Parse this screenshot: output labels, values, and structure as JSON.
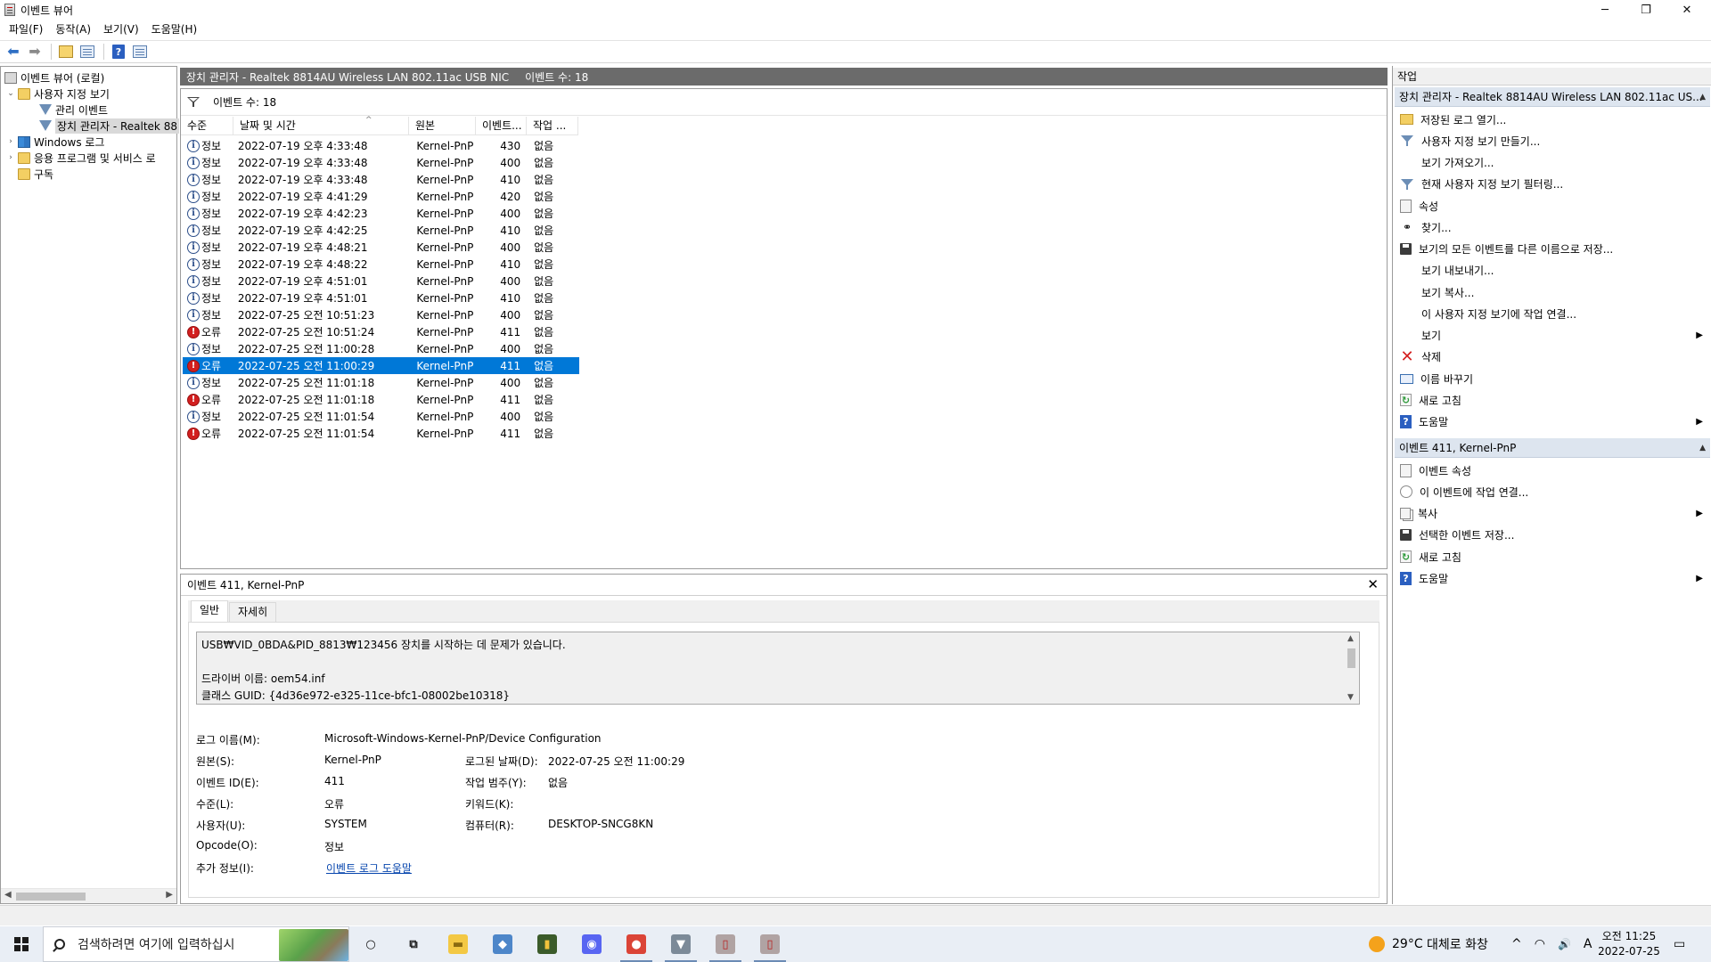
{
  "window": {
    "title": "이벤트 뷰어",
    "controls": {
      "minimize": "─",
      "maximize": "❐",
      "close": "✕"
    }
  },
  "menu": [
    "파일(F)",
    "동작(A)",
    "보기(V)",
    "도움말(H)"
  ],
  "toolbar": {
    "icons": [
      "back-arrow-icon",
      "forward-arrow-icon",
      "up-folder-icon",
      "show-hide-tree-icon",
      "help-icon",
      "action-pane-icon"
    ],
    "back_glyph": "⬅",
    "forward_glyph": "➡",
    "help_glyph": "?"
  },
  "tree": {
    "items": [
      {
        "label": "이벤트 뷰어 (로컬)",
        "expander": "",
        "icon": "computer-icon"
      },
      {
        "label": "사용자 지정 보기",
        "expander": "⌄",
        "icon": "folder-icon"
      },
      {
        "label": "관리 이벤트",
        "expander": "",
        "icon": "filter-icon"
      },
      {
        "label": "장치 관리자 - Realtek 88",
        "expander": "",
        "icon": "filter-icon"
      },
      {
        "label": "Windows 로그",
        "expander": "›",
        "icon": "windows-log-icon"
      },
      {
        "label": "응용 프로그램 및 서비스 로",
        "expander": "›",
        "icon": "folder-icon"
      },
      {
        "label": "구독",
        "expander": "",
        "icon": "folder-icon"
      }
    ],
    "selected_index": 3
  },
  "center": {
    "header_title": "장치 관리자 - Realtek 8814AU Wireless LAN 802.11ac USB NIC",
    "header_count": "이벤트 수: 18",
    "filter_text": "이벤트 수: 18",
    "columns": [
      "수준",
      "날짜 및 시간",
      "원본",
      "이벤트...",
      "작업 ..."
    ],
    "sort_glyph": "^",
    "rows": [
      {
        "level": "정보",
        "type": "info",
        "datetime": "2022-07-19 오후 4:33:48",
        "source": "Kernel-PnP",
        "id": "430",
        "task": "없음"
      },
      {
        "level": "정보",
        "type": "info",
        "datetime": "2022-07-19 오후 4:33:48",
        "source": "Kernel-PnP",
        "id": "400",
        "task": "없음"
      },
      {
        "level": "정보",
        "type": "info",
        "datetime": "2022-07-19 오후 4:33:48",
        "source": "Kernel-PnP",
        "id": "410",
        "task": "없음"
      },
      {
        "level": "정보",
        "type": "info",
        "datetime": "2022-07-19 오후 4:41:29",
        "source": "Kernel-PnP",
        "id": "420",
        "task": "없음"
      },
      {
        "level": "정보",
        "type": "info",
        "datetime": "2022-07-19 오후 4:42:23",
        "source": "Kernel-PnP",
        "id": "400",
        "task": "없음"
      },
      {
        "level": "정보",
        "type": "info",
        "datetime": "2022-07-19 오후 4:42:25",
        "source": "Kernel-PnP",
        "id": "410",
        "task": "없음"
      },
      {
        "level": "정보",
        "type": "info",
        "datetime": "2022-07-19 오후 4:48:21",
        "source": "Kernel-PnP",
        "id": "400",
        "task": "없음"
      },
      {
        "level": "정보",
        "type": "info",
        "datetime": "2022-07-19 오후 4:48:22",
        "source": "Kernel-PnP",
        "id": "410",
        "task": "없음"
      },
      {
        "level": "정보",
        "type": "info",
        "datetime": "2022-07-19 오후 4:51:01",
        "source": "Kernel-PnP",
        "id": "400",
        "task": "없음"
      },
      {
        "level": "정보",
        "type": "info",
        "datetime": "2022-07-19 오후 4:51:01",
        "source": "Kernel-PnP",
        "id": "410",
        "task": "없음"
      },
      {
        "level": "정보",
        "type": "info",
        "datetime": "2022-07-25 오전 10:51:23",
        "source": "Kernel-PnP",
        "id": "400",
        "task": "없음"
      },
      {
        "level": "오류",
        "type": "error",
        "datetime": "2022-07-25 오전 10:51:24",
        "source": "Kernel-PnP",
        "id": "411",
        "task": "없음"
      },
      {
        "level": "정보",
        "type": "info",
        "datetime": "2022-07-25 오전 11:00:28",
        "source": "Kernel-PnP",
        "id": "400",
        "task": "없음"
      },
      {
        "level": "오류",
        "type": "error",
        "datetime": "2022-07-25 오전 11:00:29",
        "source": "Kernel-PnP",
        "id": "411",
        "task": "없음"
      },
      {
        "level": "정보",
        "type": "info",
        "datetime": "2022-07-25 오전 11:01:18",
        "source": "Kernel-PnP",
        "id": "400",
        "task": "없음"
      },
      {
        "level": "오류",
        "type": "error",
        "datetime": "2022-07-25 오전 11:01:18",
        "source": "Kernel-PnP",
        "id": "411",
        "task": "없음"
      },
      {
        "level": "정보",
        "type": "info",
        "datetime": "2022-07-25 오전 11:01:54",
        "source": "Kernel-PnP",
        "id": "400",
        "task": "없음"
      },
      {
        "level": "오류",
        "type": "error",
        "datetime": "2022-07-25 오전 11:01:54",
        "source": "Kernel-PnP",
        "id": "411",
        "task": "없음"
      }
    ],
    "selected_row": 13
  },
  "detail": {
    "title": "이벤트 411, Kernel-PnP",
    "close_glyph": "✕",
    "tabs": [
      "일반",
      "자세히"
    ],
    "message_lines": [
      "USB₩VID_0BDA&PID_8813₩123456 장치를 시작하는 데 문제가 있습니다.",
      "",
      "드라이버 이름: oem54.inf",
      "클래스 GUID: {4d36e972-e325-11ce-bfc1-08002be10318}"
    ],
    "props": {
      "log_name_label": "로그 이름(M):",
      "log_name": "Microsoft-Windows-Kernel-PnP/Device Configuration",
      "source_label": "원본(S):",
      "source": "Kernel-PnP",
      "logged_label": "로그된 날짜(D):",
      "logged": "2022-07-25 오전 11:00:29",
      "event_id_label": "이벤트 ID(E):",
      "event_id": "411",
      "task_label": "작업 범주(Y):",
      "task": "없음",
      "level_label": "수준(L):",
      "level": "오류",
      "keywords_label": "키워드(K):",
      "keywords": "",
      "user_label": "사용자(U):",
      "user": "SYSTEM",
      "computer_label": "컴퓨터(R):",
      "computer": "DESKTOP-SNCG8KN",
      "opcode_label": "Opcode(O):",
      "opcode": "정보",
      "more_info_label": "추가 정보(I):",
      "more_info_link": "이벤트 로그 도움말"
    }
  },
  "actions": {
    "title": "작업",
    "section1": "장치 관리자 - Realtek 8814AU Wireless LAN 802.11ac US...",
    "section1_items": [
      {
        "label": "저장된 로그 열기...",
        "icon": "open-log-icon",
        "submenu": false
      },
      {
        "label": "사용자 지정 보기 만들기...",
        "icon": "create-view-icon",
        "submenu": false
      },
      {
        "label": "보기 가져오기...",
        "icon": "",
        "submenu": false
      },
      {
        "label": "현재 사용자 지정 보기 필터링...",
        "icon": "filter-icon",
        "submenu": false
      },
      {
        "label": "속성",
        "icon": "properties-icon",
        "submenu": false
      },
      {
        "label": "찾기...",
        "icon": "find-icon",
        "submenu": false
      },
      {
        "label": "보기의 모든 이벤트를 다른 이름으로 저장...",
        "icon": "save-icon",
        "submenu": false
      },
      {
        "label": "보기 내보내기...",
        "icon": "",
        "submenu": false
      },
      {
        "label": "보기 복사...",
        "icon": "",
        "submenu": false
      },
      {
        "label": "이 사용자 지정 보기에 작업 연결...",
        "icon": "",
        "submenu": false
      },
      {
        "label": "보기",
        "icon": "",
        "submenu": true
      },
      {
        "label": "삭제",
        "icon": "delete-icon",
        "submenu": false
      },
      {
        "label": "이름 바꾸기",
        "icon": "rename-icon",
        "submenu": false
      },
      {
        "label": "새로 고침",
        "icon": "refresh-icon",
        "submenu": false
      },
      {
        "label": "도움말",
        "icon": "help-icon",
        "submenu": true
      }
    ],
    "section2": "이벤트 411, Kernel-PnP",
    "section2_items": [
      {
        "label": "이벤트 속성",
        "icon": "event-properties-icon",
        "submenu": false
      },
      {
        "label": "이 이벤트에 작업 연결...",
        "icon": "attach-task-icon",
        "submenu": false
      },
      {
        "label": "복사",
        "icon": "copy-icon",
        "submenu": true
      },
      {
        "label": "선택한 이벤트 저장...",
        "icon": "save-icon",
        "submenu": false
      },
      {
        "label": "새로 고침",
        "icon": "refresh-icon",
        "submenu": false
      },
      {
        "label": "도움말",
        "icon": "help-icon",
        "submenu": true
      }
    ],
    "collapse_glyph": "▲",
    "submenu_glyph": "▶"
  },
  "taskbar": {
    "search_placeholder": "검색하려면 여기에 입력하십시",
    "apps": [
      {
        "name": "cortana-icon",
        "glyph": "○",
        "color": "#e9eef5",
        "fg": "#111"
      },
      {
        "name": "task-view-icon",
        "glyph": "⧉",
        "color": "#e9eef5",
        "fg": "#111"
      },
      {
        "name": "file-explorer-icon",
        "glyph": "▬",
        "color": "#f3c844",
        "fg": "#8a6a10"
      },
      {
        "name": "pc-manager-icon",
        "glyph": "◆",
        "color": "#4d86c9",
        "fg": "#fff"
      },
      {
        "name": "book-app-icon",
        "glyph": "▮",
        "color": "#3b5b2a",
        "fg": "#f0c23b"
      },
      {
        "name": "discord-icon",
        "glyph": "◉",
        "color": "#5865f2",
        "fg": "#fff"
      },
      {
        "name": "chrome-icon",
        "glyph": "●",
        "color": "#db4437",
        "fg": "#fff"
      },
      {
        "name": "installer-icon",
        "glyph": "▼",
        "color": "#7c8a98",
        "fg": "#fff"
      },
      {
        "name": "usb-device-icon",
        "glyph": "▯",
        "color": "#b0a3a3",
        "fg": "#b82020"
      },
      {
        "name": "usb-device-2-icon",
        "glyph": "▯",
        "color": "#b0a3a3",
        "fg": "#b82020"
      }
    ],
    "weather_temp": "29°C",
    "weather_text": "대체로 화창",
    "tray_glyphs": {
      "chevron": "^",
      "network": "◠",
      "volume": "🔊",
      "ime": "A"
    },
    "clock_time": "오전 11:25",
    "clock_date": "2022-07-25",
    "notification_glyph": "▭"
  }
}
